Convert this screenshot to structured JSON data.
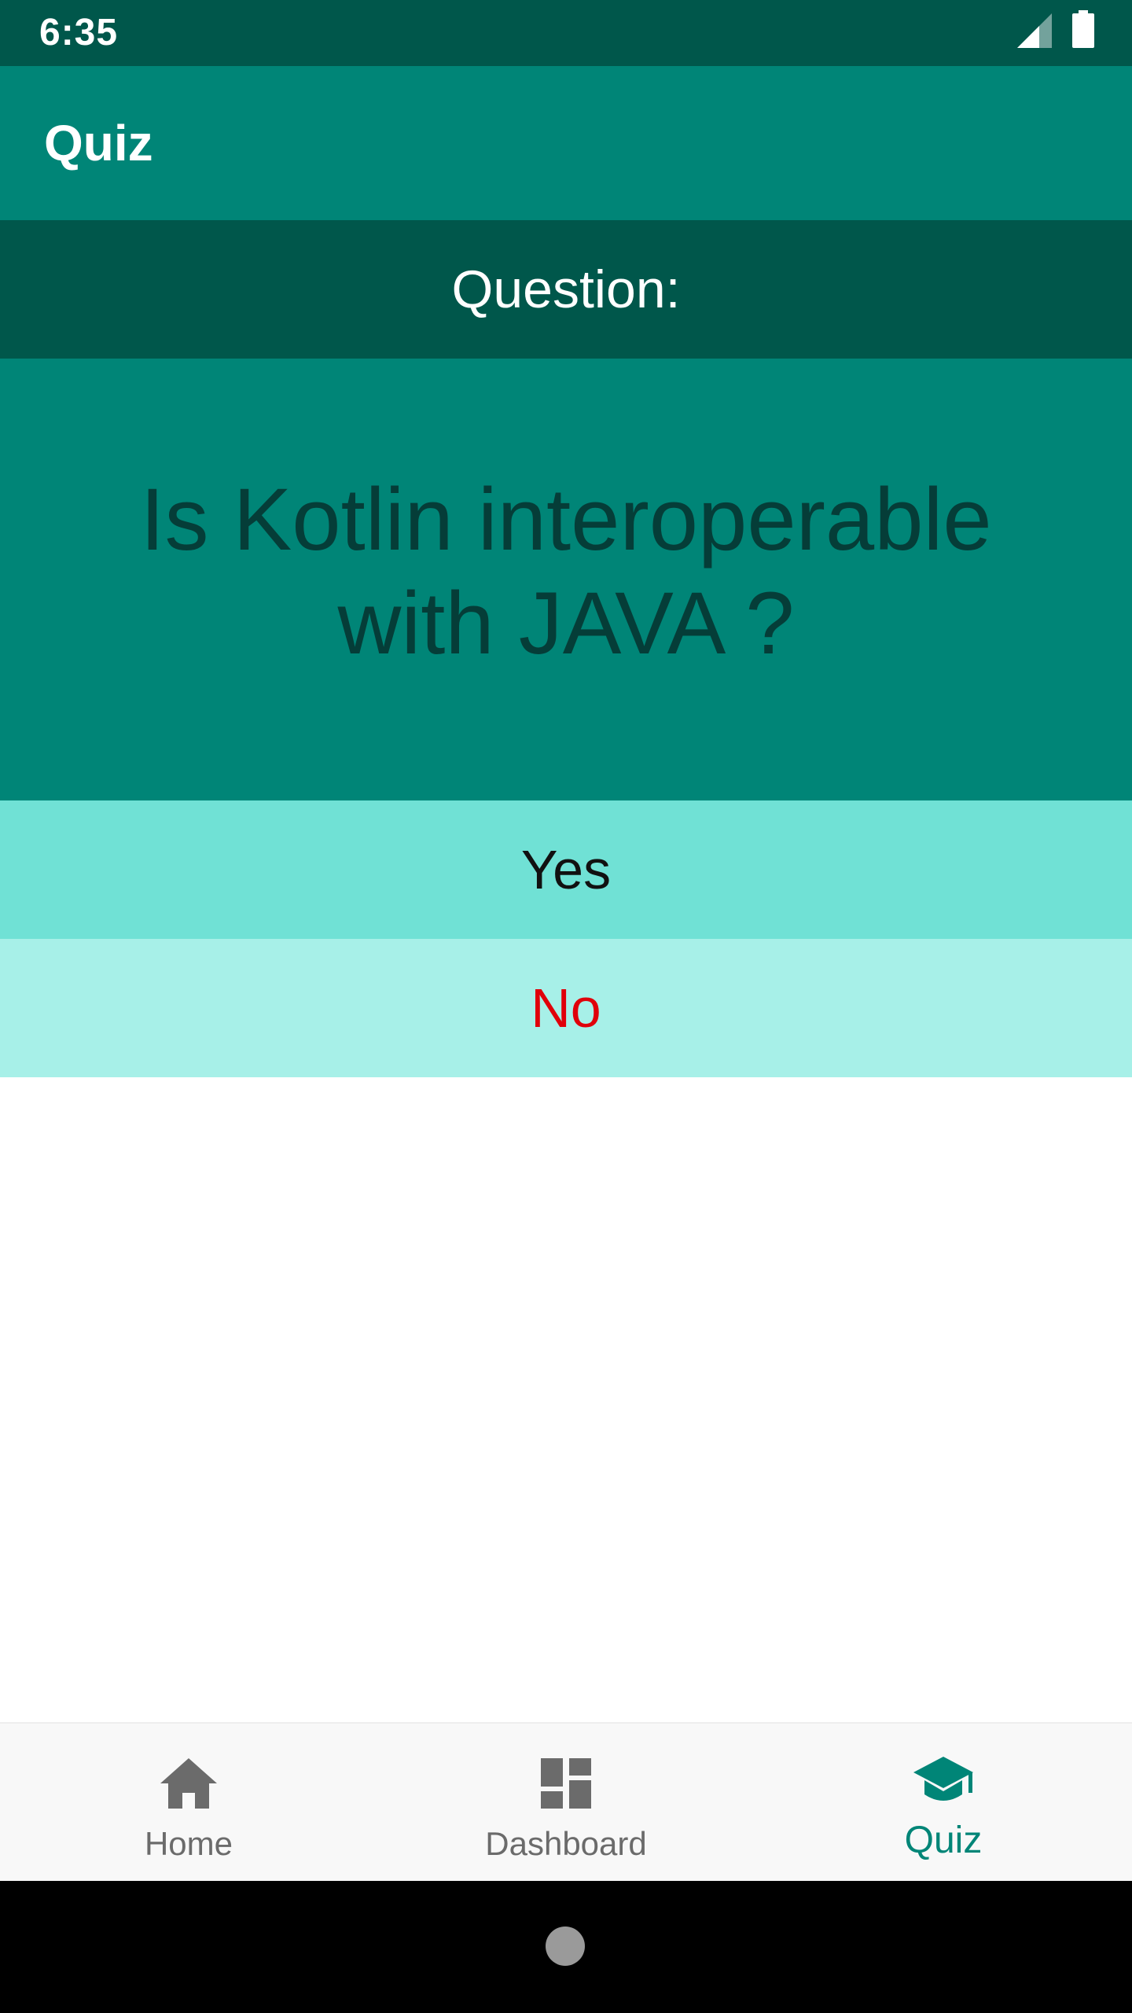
{
  "status_bar": {
    "time": "6:35",
    "icons": [
      "signal-icon",
      "battery-icon"
    ]
  },
  "app_bar": {
    "title": "Quiz"
  },
  "question": {
    "header": "Question:",
    "text": "Is Kotlin interoperable with JAVA ?"
  },
  "answers": {
    "yes_label": "Yes",
    "no_label": "No"
  },
  "bottom_nav": {
    "items": [
      {
        "label": "Home",
        "icon": "home-icon",
        "active": false
      },
      {
        "label": "Dashboard",
        "icon": "dashboard-icon",
        "active": false
      },
      {
        "label": "Quiz",
        "icon": "graduation-cap-icon",
        "active": true
      }
    ]
  },
  "colors": {
    "primary_dark": "#00574b",
    "primary": "#008577",
    "answer_yes_bg": "#70e1d5",
    "answer_no_bg": "#a7f0e8",
    "answer_no_text": "#e0000a",
    "nav_active": "#008577",
    "nav_inactive": "#6b6b6b"
  }
}
